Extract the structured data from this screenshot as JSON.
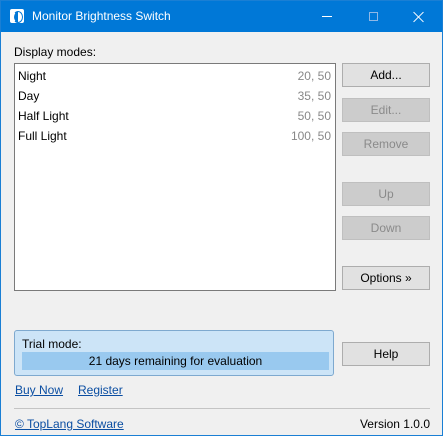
{
  "window": {
    "title": "Monitor Brightness Switch",
    "icon": "monitor-brightness-app-icon",
    "controls": {
      "minimize": "minimize-icon",
      "maximize": "maximize-icon",
      "close": "close-icon"
    }
  },
  "display_modes": {
    "label": "Display modes:",
    "items": [
      {
        "name": "Night",
        "value": "20, 50"
      },
      {
        "name": "Day",
        "value": "35, 50"
      },
      {
        "name": "Half Light",
        "value": "50, 50"
      },
      {
        "name": "Full Light",
        "value": "100, 50"
      }
    ]
  },
  "buttons": {
    "add": "Add...",
    "edit": "Edit...",
    "remove": "Remove",
    "up": "Up",
    "down": "Down",
    "options": "Options »",
    "help": "Help"
  },
  "trial": {
    "label": "Trial mode:",
    "status": "21 days remaining for evaluation"
  },
  "links": {
    "buy_now": "Buy Now",
    "register": "Register",
    "copyright": "© TopLang Software"
  },
  "version": "Version 1.0.0",
  "colors": {
    "titlebar": "#0078d7",
    "trial_background": "#cce4f7",
    "trial_bar": "#99c9ef",
    "link": "#0b4ea2"
  }
}
